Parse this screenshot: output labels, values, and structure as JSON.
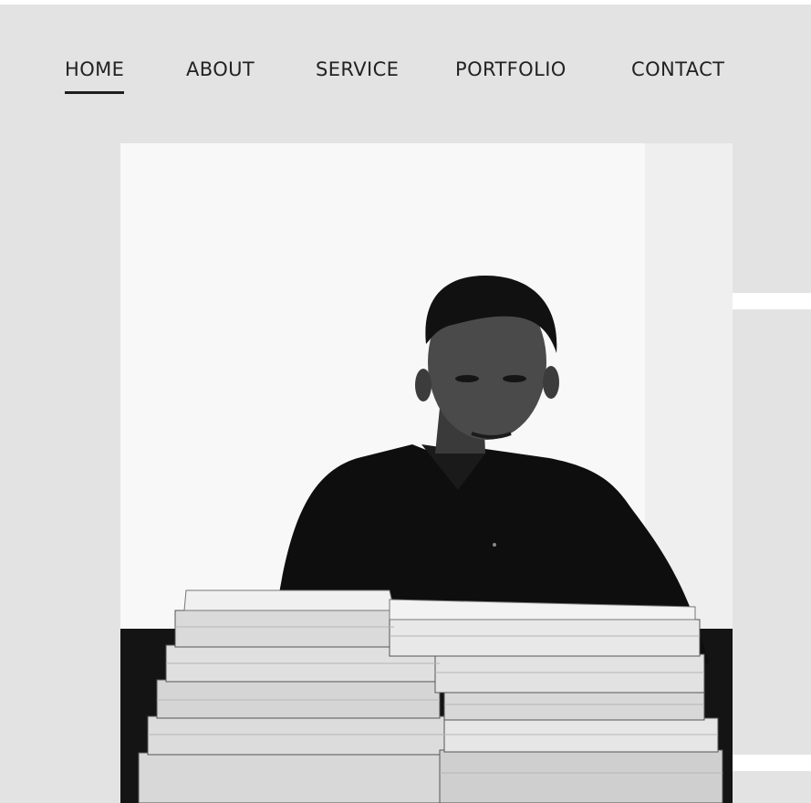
{
  "nav": {
    "items": [
      {
        "label": "HOME",
        "active": true
      },
      {
        "label": "ABOUT",
        "active": false
      },
      {
        "label": "SERVICE",
        "active": false
      },
      {
        "label": "PORTFOLIO",
        "active": false
      },
      {
        "label": "CONTACT",
        "active": false
      }
    ]
  },
  "hero": {
    "image_description": "Black-and-white portrait photo of a man in a dark shirt sitting behind stacks of books"
  },
  "colors": {
    "background": "#e3e3e3",
    "nav_text": "#222222",
    "active_underline": "#1e1e1e",
    "accent_stripe": "#ffffff"
  }
}
